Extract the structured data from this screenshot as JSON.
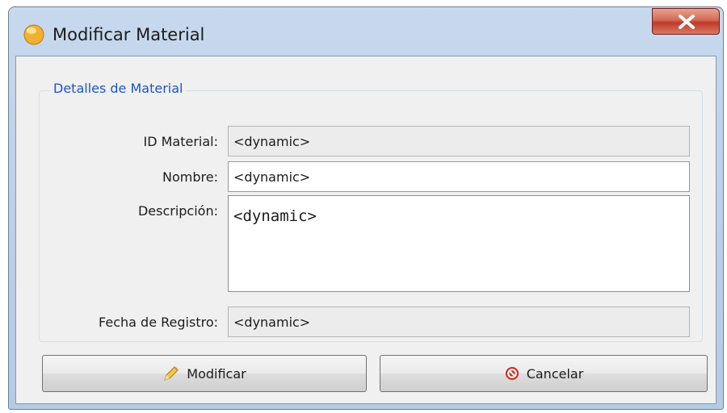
{
  "window": {
    "title": "Modificar Material"
  },
  "icons": {
    "app": "app-icon",
    "close": "close-icon",
    "edit": "pencil-icon",
    "cancel": "stop-icon"
  },
  "group": {
    "legend": "Detalles de Material"
  },
  "form": {
    "id_label": "ID Material:",
    "id_value": "<dynamic>",
    "nombre_label": "Nombre:",
    "nombre_value": "<dynamic>",
    "descripcion_label": "Descripción:",
    "descripcion_value": "<dynamic>",
    "fecha_label": "Fecha de Registro:",
    "fecha_value": "<dynamic>"
  },
  "buttons": {
    "modificar": "Modificar",
    "cancelar": "Cancelar"
  },
  "colors": {
    "legend": "#1e55c8",
    "close_button": "#c0392b",
    "cancel_icon": "#d0281d"
  }
}
